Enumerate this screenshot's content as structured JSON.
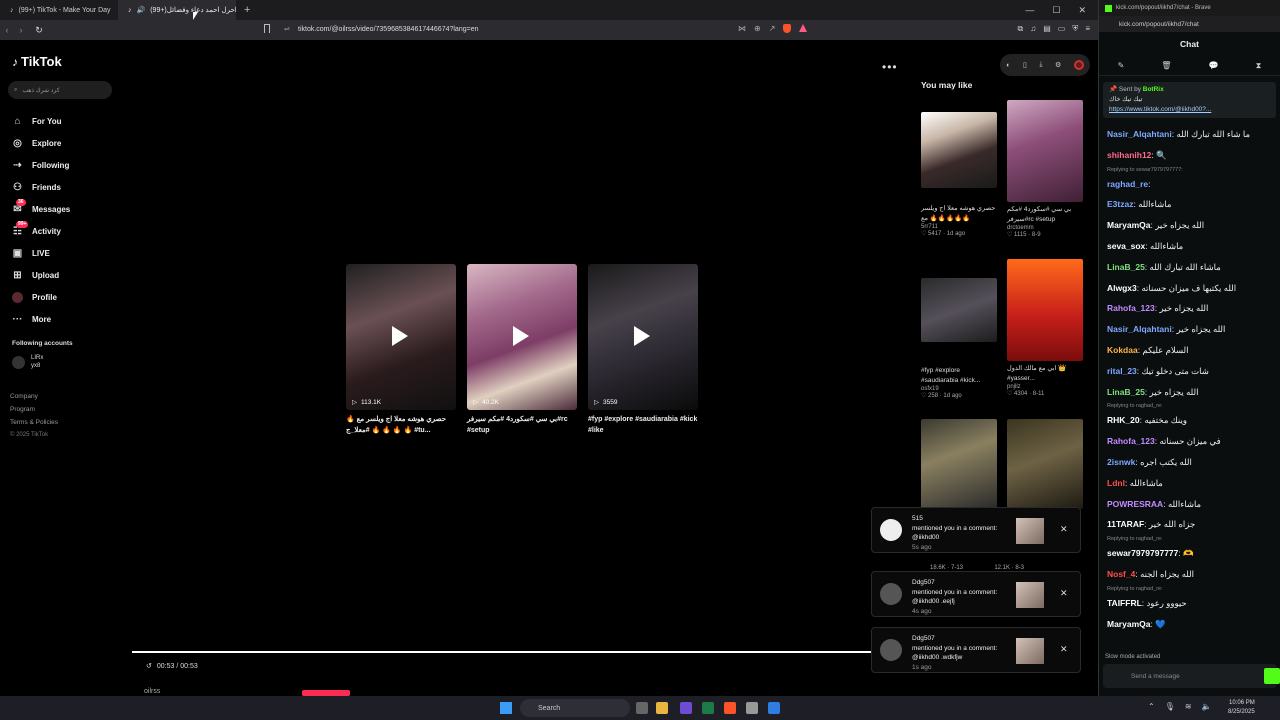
{
  "browser": {
    "tabs": [
      {
        "title": "(99+) TikTok - Make Your Day",
        "active": false
      },
      {
        "title": "(99+)احرل احمد دعاء وفضائل",
        "active": true
      }
    ],
    "url": "tiktok.com/@oilrss/video/7359685384617446674?lang=en"
  },
  "sidebar": {
    "logo": "TikTok",
    "search_placeholder": "كرد شرك ذهب",
    "items": [
      {
        "label": "For You",
        "icon": "home-icon"
      },
      {
        "label": "Explore",
        "icon": "compass-icon"
      },
      {
        "label": "Following",
        "icon": "following-icon"
      },
      {
        "label": "Friends",
        "icon": "friends-icon"
      },
      {
        "label": "Messages",
        "icon": "messages-icon",
        "badge": "36"
      },
      {
        "label": "Activity",
        "icon": "activity-icon",
        "badge": "99+"
      },
      {
        "label": "LIVE",
        "icon": "live-icon"
      },
      {
        "label": "Upload",
        "icon": "upload-icon"
      },
      {
        "label": "Profile",
        "icon": "profile-icon"
      },
      {
        "label": "More",
        "icon": "more-icon"
      }
    ],
    "following_heading": "Following accounts",
    "following_account": {
      "name": "LIRx",
      "handle": "yx8"
    },
    "footer": [
      "Company",
      "Program",
      "Terms & Policies"
    ],
    "copyright": "© 2025 TikTok"
  },
  "main": {
    "videos": [
      {
        "views": "113.1K",
        "caption": "حصري هوشه معلا اج ويلسر مع 🔥 🔥 🔥 🔥 🔥 #معلا_ج #tu..."
      },
      {
        "views": "40.2K",
        "caption": "بي سي #سكورد4 #مكم سيرفر#rc #setup"
      },
      {
        "views": "3559",
        "caption": "#fyp #explore #saudiarabia #kick #like"
      }
    ],
    "time": "00:53 / 00:53",
    "author": "oilrss"
  },
  "right": {
    "heading": "You may like",
    "cards": [
      {
        "caption": "حصري هوشه معلا اج ويلسر مع 🔥🔥🔥🔥🔥",
        "author": "5rr711",
        "likes": "5417",
        "date": "1d ago"
      },
      {
        "caption": "بي سي #سكورد4 #مكم سيرفر#rc #setup",
        "author": "drctoemm",
        "likes": "1115",
        "date": "8-9"
      },
      {
        "caption": "#fyp #explore #saudiarabia #kick...",
        "author": "osfx19",
        "likes": "258",
        "date": "1d ago"
      },
      {
        "caption": "ابي مع مالك الدول 👑 #yasser...",
        "author": "pnjllz",
        "likes": "4304",
        "date": "8-11"
      }
    ]
  },
  "notifications": [
    {
      "user": "515",
      "text": "mentioned you in a comment: @iikhd00",
      "ago": "5s ago"
    },
    {
      "user": "Ddg507",
      "text": "mentioned you in a comment: @iikhd00 .eejfj",
      "ago": "4s ago"
    },
    {
      "user": "Ddg507",
      "text": "mentioned you in a comment: @iikhd00 .wdkfjw",
      "ago": "1s ago"
    }
  ],
  "notif_stats": [
    "18.6K · 7-13",
    "12.1K · 8-3"
  ],
  "chat": {
    "window_title": "kick.com/popout/iikhd7/chat - Brave",
    "url": "kick.com/popout/iikhd7/chat",
    "heading": "Chat",
    "pinned_sender": "Sent by",
    "pinned_bot": "BotRix",
    "pinned_text": "تيك تيك خاك",
    "pinned_link": "https://www.tiktok.com/@iikhd00?...",
    "messages": [
      {
        "user": "Nasir_Alqahtani",
        "color": "#7fa8ff",
        "text": "ما شاء الله تبارك الله"
      },
      {
        "user": "shihanih12",
        "color": "#ff6b8a",
        "text": "🔍"
      },
      {
        "user": "raghad_re",
        "color": "#7fa8ff",
        "text": "",
        "reply": "Replying to sewar7979797777:"
      },
      {
        "user": "E3tzaz",
        "color": "#7fa8ff",
        "text": "ماشاءالله"
      },
      {
        "user": "MaryamQa",
        "color": "#ffffff",
        "text": "الله يجزاه خير"
      },
      {
        "user": "seva_sox",
        "color": "#ffffff",
        "text": "ماشاءالله"
      },
      {
        "user": "LinaB_25",
        "color": "#7fe07f",
        "text": "ماشاء الله تبارك الله"
      },
      {
        "user": "Alwgx3",
        "color": "#ffffff",
        "text": "الله يكتبها ف ميزان حسناته"
      },
      {
        "user": "Rahofa_123",
        "color": "#c38bff",
        "text": "الله يجزاه خير"
      },
      {
        "user": "Nasir_Alqahtani",
        "color": "#7fa8ff",
        "text": "الله يجزاه خير"
      },
      {
        "user": "Kokdaa",
        "color": "#ffb347",
        "text": "السلام عليكم"
      },
      {
        "user": "rital_23",
        "color": "#7fa8ff",
        "text": "شات متى دخلو تيك"
      },
      {
        "user": "LinaB_25",
        "color": "#7fe07f",
        "text": "الله يجزاه خير"
      },
      {
        "user": "RHK_20",
        "color": "#ffffff",
        "text": "وينك مختفيه",
        "reply": "Replying to raghad_re:"
      },
      {
        "user": "Rahofa_123",
        "color": "#c38bff",
        "text": "في ميزان حسناته"
      },
      {
        "user": "2isnwk",
        "color": "#7fa8ff",
        "text": "الله يكتب اجره"
      },
      {
        "user": "Ldnl",
        "color": "#ff4d4d",
        "text": "ماشاءالله"
      },
      {
        "user": "POWRESRAA",
        "color": "#c38bff",
        "text": "ماشاءالله"
      },
      {
        "user": "11TARAF",
        "color": "#ffffff",
        "text": "جزاه الله خير"
      },
      {
        "user": "sewar7979797777",
        "color": "#ffffff",
        "text": "🫶",
        "reply": "Replying to raghad_re:"
      },
      {
        "user": "Nosf_4",
        "color": "#ff4d4d",
        "text": "الله يجزاه الجنه"
      },
      {
        "user": "TAIFFRL",
        "color": "#ffffff",
        "text": "حيووو رعود",
        "reply": "Replying to raghad_re:"
      },
      {
        "user": "MaryamQa",
        "color": "#ffffff",
        "text": "💙"
      }
    ],
    "slow_mode": "Slow mode activated",
    "input_placeholder": "Send a message"
  },
  "taskbar": {
    "search": "Search",
    "time": "10:06 PM",
    "date": "8/25/2025"
  }
}
